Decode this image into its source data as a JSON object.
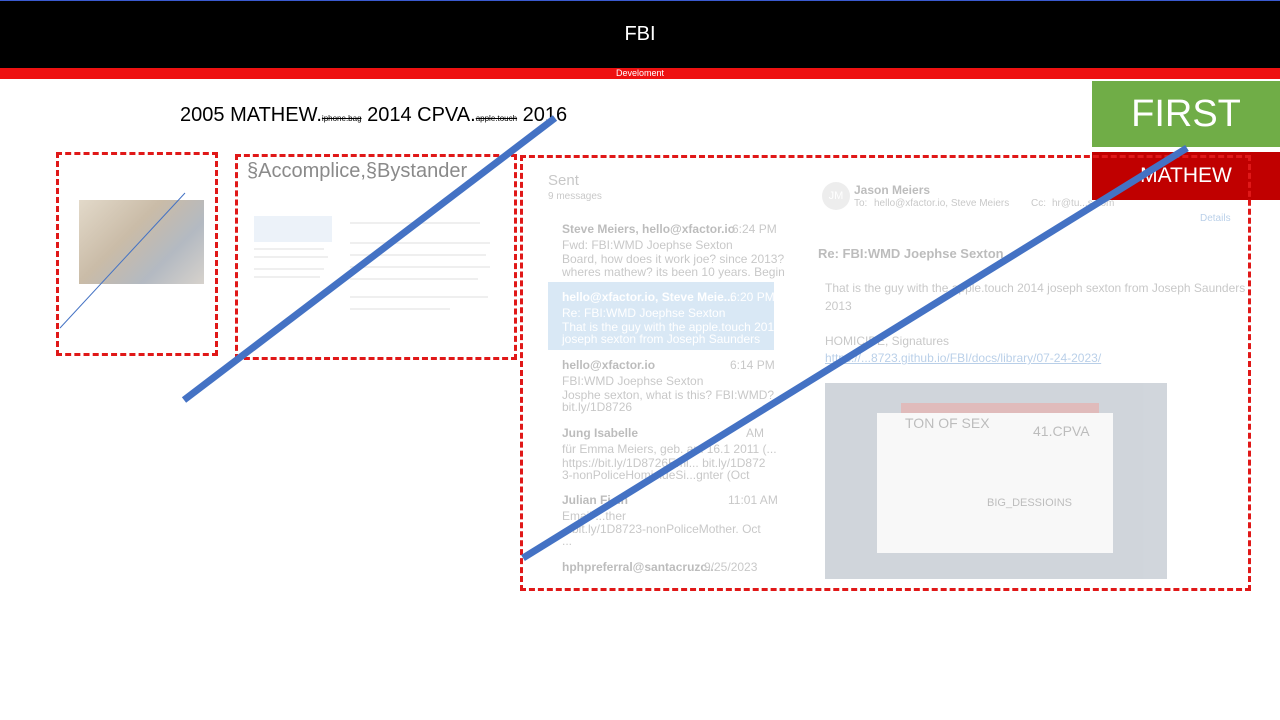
{
  "header": {
    "title": "FBI",
    "subtitle": "Develoment"
  },
  "timeline": {
    "y1": "2005",
    "n1": "MATHEW.",
    "s1": "iphone.bag",
    "y2": "2014",
    "n2": "CPVA.",
    "s2": "apple.touch",
    "y3": "2016"
  },
  "badges": {
    "first": "FIRST",
    "mathew": "MATHEW"
  },
  "accomplice": {
    "title": "§Accomplice,§Bystander"
  },
  "mail": {
    "folder": "Sent",
    "count": "9 messages",
    "items": [
      {
        "from": "Steve Meiers, hello@xfactor.io",
        "time": "6:24 PM",
        "subject": "Fwd: FBI:WMD Joephse Sexton",
        "preview1": "Board, how does it work joe? since 2013?",
        "preview2": "wheres mathew? its been 10 years. Begin"
      },
      {
        "from": "hello@xfactor.io, Steve Meie...",
        "time": "6:20 PM",
        "subject": "Re: FBI:WMD Joephse Sexton",
        "preview1": "That is the guy with the apple.touch 2014",
        "preview2": "joseph sexton from Joseph Saunders"
      },
      {
        "from": "hello@xfactor.io",
        "time": "6:14 PM",
        "subject": "FBI:WMD Joephse Sexton",
        "preview1": "Josphe sexton, what is this? FBI:WMD?",
        "preview2": "bit.ly/1D8726"
      },
      {
        "from": "Jung Isabelle",
        "time": "AM",
        "subject": "für Emma Meiers, geb. am 16.1 2011 (...",
        "preview1": "https://bit.ly/1D8726Emi... bit.ly/1D872",
        "preview2": "3-nonPoliceHomicideSi...gnter (Oct"
      },
      {
        "from": "Julian Fi...n",
        "time": "11:01 AM",
        "subject": "Email ...ther",
        "preview1": "...bit.ly/1D8723-nonPoliceMother. Oct",
        "preview2": "..."
      },
      {
        "from": "hphpreferral@santacruzc...",
        "time": "9/25/2023",
        "subject": "",
        "preview1": "",
        "preview2": ""
      }
    ],
    "reader": {
      "avatar": "JM",
      "sender": "Jason Meiers",
      "to_label": "To:",
      "to": "hello@xfactor.io,    Steve Meiers",
      "cc_label": "Cc:",
      "cc": "hr@tu...s.com",
      "details": "Details",
      "subject": "Re: FBI:WMD Joephse Sexton",
      "body1": "That is the guy with the apple.touch 2014 joseph sexton from Joseph Saunders",
      "body2": "2013",
      "sig": "HOMICIDE, Signatures",
      "link": "https://...8723.github.io/FBI/docs/library/07-24-2023/",
      "shot_text1": "TON OF SEX",
      "shot_text2": "41.CPVA",
      "shot_text3": "BIG_DESSIOINS"
    }
  }
}
